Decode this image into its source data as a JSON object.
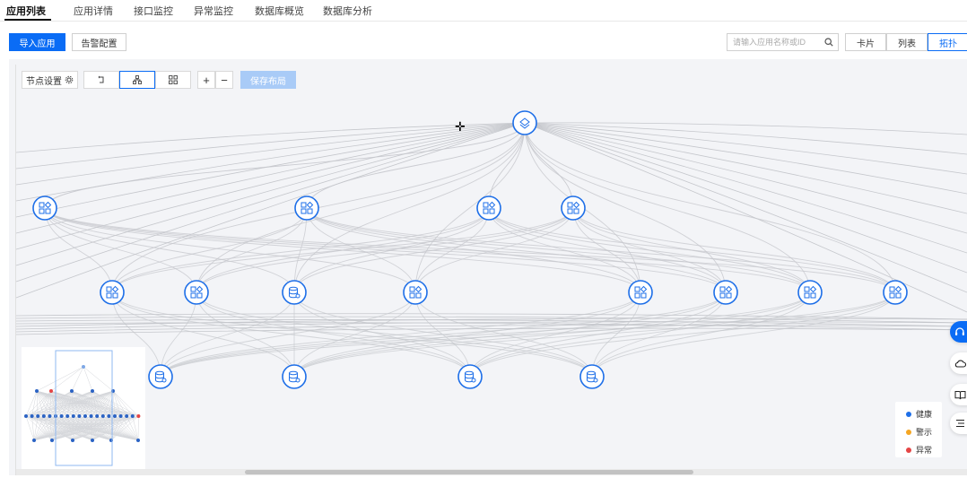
{
  "tabs": [
    "应用列表",
    "应用详情",
    "接口监控",
    "异常监控",
    "数据库概览",
    "数据库分析"
  ],
  "actions": {
    "import_app": "导入应用",
    "alert_config": "告警配置"
  },
  "search": {
    "placeholder": "请输入应用名称或ID"
  },
  "view_modes": [
    "卡片",
    "列表",
    "拓扑"
  ],
  "toolbar": {
    "node_settings": "节点设置",
    "zoom_in": "+",
    "zoom_out": "−",
    "save_layout": "保存布局"
  },
  "legend": [
    {
      "label": "健康",
      "color": "#1e6fe8"
    },
    {
      "label": "警示",
      "color": "#f5a623"
    },
    {
      "label": "异常",
      "color": "#e54545"
    }
  ],
  "colors": {
    "accent": "#0a6cf5",
    "node": "#1e6fe8",
    "edge": "#c5c7cc"
  },
  "graph": {
    "root": {
      "icon": "layers-icon"
    },
    "level1": [
      "app-icon",
      "app-icon",
      "app-icon",
      "app-icon"
    ],
    "level2": [
      "app-icon",
      "app-icon",
      "db-icon",
      "app-icon",
      "app-icon",
      "app-icon",
      "app-icon",
      "app-icon"
    ],
    "level3": [
      "db-icon",
      "db-icon",
      "db-icon",
      "db-icon"
    ]
  },
  "side_icons": [
    "headset-icon",
    "cloud-icon",
    "book-icon",
    "list-icon"
  ]
}
